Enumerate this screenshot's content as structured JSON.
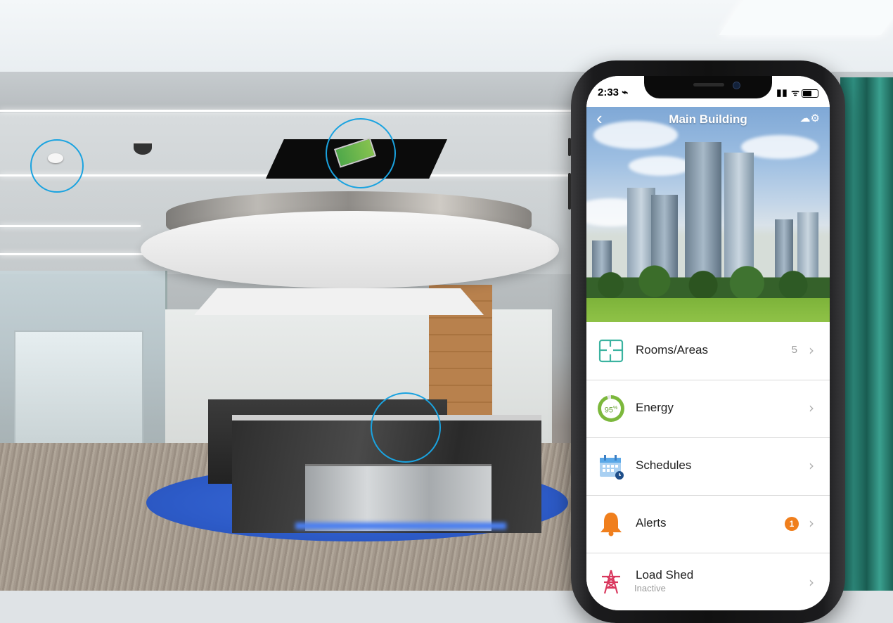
{
  "status_bar": {
    "time": "2:33 ⌁",
    "icons": "▮▮ ᯤ"
  },
  "nav": {
    "title": "Main Building",
    "back_glyph": "‹",
    "settings_glyph": "☁⚙"
  },
  "menu": [
    {
      "label": "Rooms/Areas",
      "count": "5",
      "icon": "floorplan-icon"
    },
    {
      "label": "Energy",
      "energy_percent": "95",
      "energy_unit": "%",
      "icon": "energy-ring-icon"
    },
    {
      "label": "Schedules",
      "icon": "calendar-icon"
    },
    {
      "label": "Alerts",
      "badge": "1",
      "icon": "bell-icon"
    },
    {
      "label": "Load Shed",
      "sublabel": "Inactive",
      "icon": "power-tower-icon"
    }
  ],
  "chevron": "›",
  "colors": {
    "accent": "#1aa3e0",
    "energy_green": "#7cb83c",
    "alert_orange": "#f07f1d",
    "icon_teal": "#3bb3a0",
    "calendar_blue": "#5aa8e8"
  }
}
